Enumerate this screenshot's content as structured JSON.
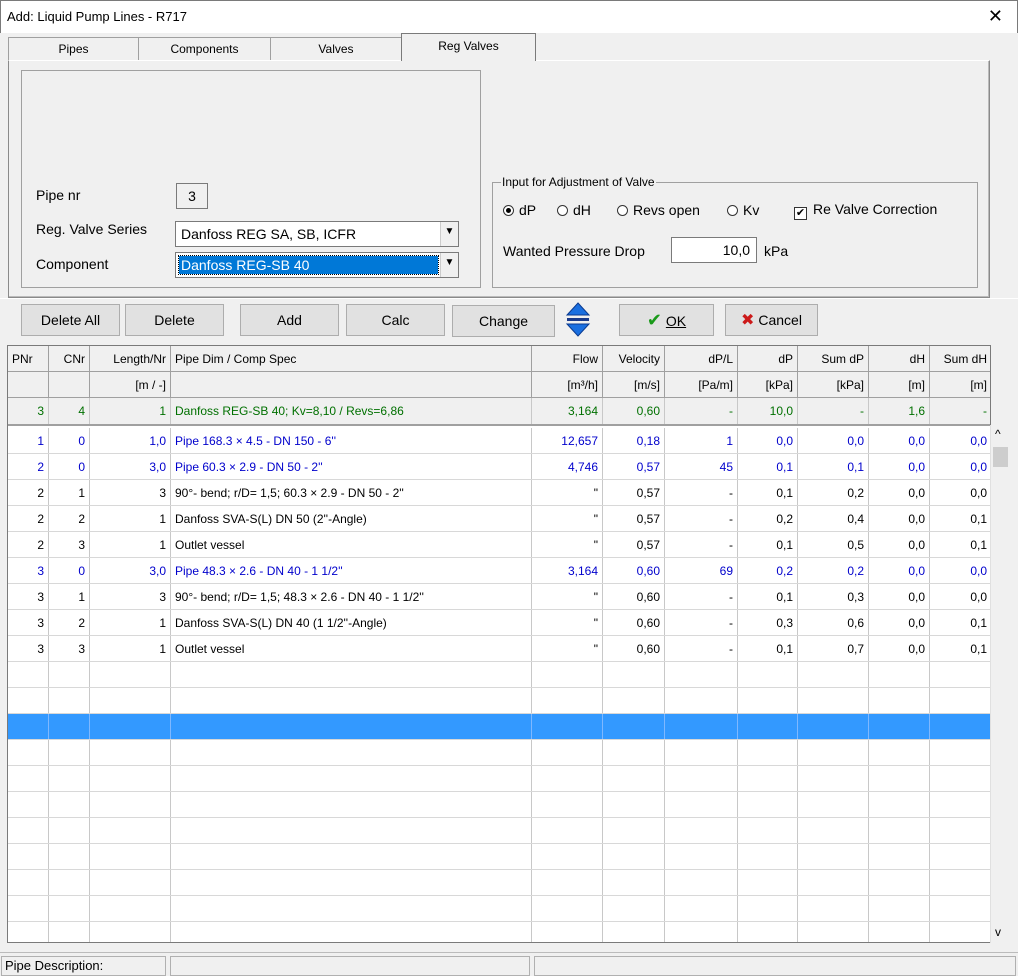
{
  "window": {
    "title": "Add:  Liquid Pump Lines  - R717",
    "close": "✕"
  },
  "tabs": [
    "Pipes",
    "Components",
    "Valves",
    "Reg Valves"
  ],
  "form": {
    "pipe_nr_label": "Pipe nr",
    "pipe_nr_value": "3",
    "series_label": "Reg. Valve Series",
    "series_value": "Danfoss REG SA, SB, ICFR",
    "component_label": "Component",
    "component_value": "Danfoss REG-SB 40"
  },
  "adjust": {
    "title": "Input for Adjustment of  Valve",
    "radios": [
      "dP",
      "dH",
      "Revs open",
      "Kv"
    ],
    "selected": "dP",
    "correction_label": "Re Valve Correction",
    "correction_checked": "✔",
    "wanted_label": "Wanted Pressure Drop",
    "wanted_value": "10,0",
    "wanted_unit": "kPa"
  },
  "toolbar": {
    "delete_all": "Delete All",
    "delete": "Delete",
    "add": "Add",
    "calc": "Calc",
    "change": "Change",
    "ok": "OK",
    "cancel": "Cancel"
  },
  "grid": {
    "headers": [
      "PNr",
      "CNr",
      "Length/Nr",
      "Pipe Dim / Comp Spec",
      "Flow",
      "Velocity",
      "dP/L",
      "dP",
      "Sum dP",
      "dH",
      "Sum dH"
    ],
    "units": [
      "",
      "",
      "[m / -]",
      "",
      "[m³/h]",
      "[m/s]",
      "[Pa/m]",
      "[kPa]",
      "[kPa]",
      "[m]",
      "[m]"
    ],
    "summary": [
      "3",
      "4",
      "1",
      "Danfoss REG-SB 40; Kv=8,10 / Revs=6,86",
      "3,164",
      "0,60",
      "-",
      "10,0",
      "-",
      "1,6",
      "-"
    ],
    "rows": [
      {
        "type": "blue",
        "cells": [
          "1",
          "0",
          "1,0",
          "Pipe 168.3 × 4.5 - DN 150 - 6''",
          "12,657",
          "0,18",
          "1",
          "0,0",
          "0,0",
          "0,0",
          "0,0"
        ]
      },
      {
        "type": "blue",
        "cells": [
          "2",
          "0",
          "3,0",
          "Pipe 60.3 × 2.9 - DN 50 - 2''",
          "4,746",
          "0,57",
          "45",
          "0,1",
          "0,1",
          "0,0",
          "0,0"
        ]
      },
      {
        "type": "black",
        "cells": [
          "2",
          "1",
          "3",
          "90°- bend; r/D= 1,5; 60.3 × 2.9 - DN 50 - 2''",
          "\"",
          "0,57",
          "-",
          "0,1",
          "0,2",
          "0,0",
          "0,0"
        ]
      },
      {
        "type": "black",
        "cells": [
          "2",
          "2",
          "1",
          "Danfoss SVA-S(L) DN 50 (2''-Angle)",
          "\"",
          "0,57",
          "-",
          "0,2",
          "0,4",
          "0,0",
          "0,1"
        ]
      },
      {
        "type": "black",
        "cells": [
          "2",
          "3",
          "1",
          "Outlet vessel",
          "\"",
          "0,57",
          "-",
          "0,1",
          "0,5",
          "0,0",
          "0,1"
        ]
      },
      {
        "type": "blue",
        "cells": [
          "3",
          "0",
          "3,0",
          "Pipe 48.3 × 2.6 - DN 40 - 1 1/2''",
          "3,164",
          "0,60",
          "69",
          "0,2",
          "0,2",
          "0,0",
          "0,0"
        ]
      },
      {
        "type": "black",
        "cells": [
          "3",
          "1",
          "3",
          "90°- bend; r/D= 1,5; 48.3 × 2.6 - DN 40 - 1 1/2''",
          "\"",
          "0,60",
          "-",
          "0,1",
          "0,3",
          "0,0",
          "0,0"
        ]
      },
      {
        "type": "black",
        "cells": [
          "3",
          "2",
          "1",
          "Danfoss SVA-S(L) DN 40 (1 1/2''-Angle)",
          "\"",
          "0,60",
          "-",
          "0,3",
          "0,6",
          "0,0",
          "0,1"
        ]
      },
      {
        "type": "black",
        "cells": [
          "3",
          "3",
          "1",
          "Outlet vessel",
          "\"",
          "0,60",
          "-",
          "0,1",
          "0,7",
          "0,0",
          "0,1"
        ]
      }
    ]
  },
  "status": {
    "description_label": "Pipe Description:"
  },
  "colors": {
    "selection": "#3399ff",
    "pipe_row": "#0000cc",
    "summary_row": "#007000"
  }
}
